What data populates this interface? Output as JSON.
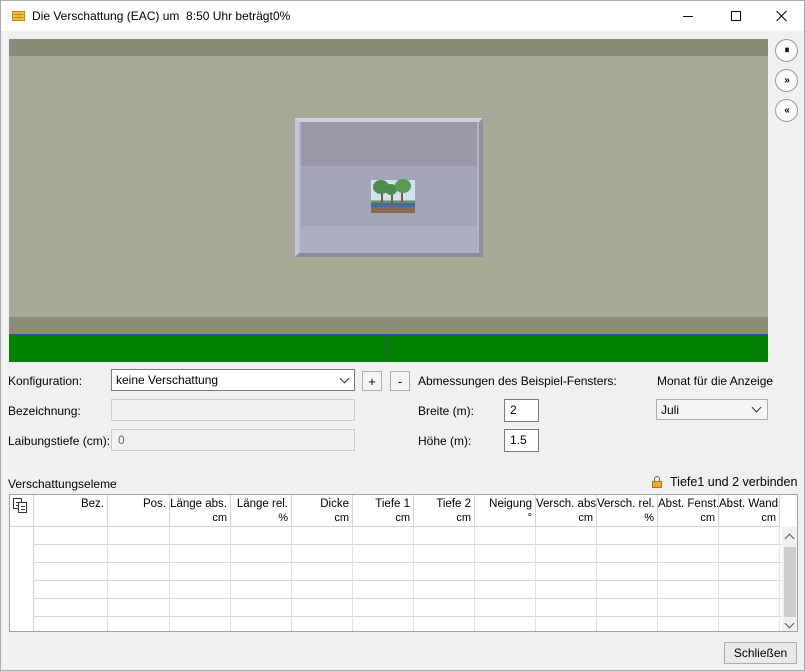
{
  "window": {
    "title": "Die Verschattung (EAC) um  8:50 Uhr beträgt",
    "percent": "0%"
  },
  "preview": {
    "controls": [
      {
        "name": "pause-button",
        "glyph": "⏸"
      },
      {
        "name": "fast-forward-button",
        "glyph": "»"
      },
      {
        "name": "rewind-button",
        "glyph": "«"
      }
    ]
  },
  "form": {
    "konfiguration_label": "Konfiguration:",
    "konfiguration_value": "keine Verschattung",
    "add_label": "+",
    "remove_label": "-",
    "bezeichnung_label": "Bezeichnung:",
    "bezeichnung_value": "",
    "laibungstiefe_label": "Laibungstiefe (cm):",
    "laibungstiefe_value": "0",
    "abmessungen_label": "Abmessungen des Beispiel-Fensters:",
    "breite_label": "Breite (m):",
    "breite_value": "2",
    "hoehe_label": "Höhe (m):",
    "hoehe_value": "1.5",
    "monat_label": "Monat für die Anzeige",
    "monat_value": "Juli"
  },
  "table": {
    "title": "Verschattungseleme",
    "link_label": "Tiefe1 und 2 verbinden",
    "columns": [
      {
        "label": "Bez.",
        "unit": ""
      },
      {
        "label": "Pos.",
        "unit": ""
      },
      {
        "label": "Länge abs.",
        "unit": "cm"
      },
      {
        "label": "Länge rel.",
        "unit": "%"
      },
      {
        "label": "Dicke",
        "unit": "cm"
      },
      {
        "label": "Tiefe 1",
        "unit": "cm"
      },
      {
        "label": "Tiefe 2",
        "unit": "cm"
      },
      {
        "label": "Neigung",
        "unit": "°"
      },
      {
        "label": "Versch. abs.",
        "unit": "cm"
      },
      {
        "label": "Versch. rel.",
        "unit": "%"
      },
      {
        "label": "Abst. Fenst.",
        "unit": "cm"
      },
      {
        "label": "Abst. Wand",
        "unit": "cm"
      }
    ],
    "rows": [
      [],
      [],
      [],
      [],
      [],
      []
    ]
  },
  "footer": {
    "close_label": "Schließen"
  }
}
